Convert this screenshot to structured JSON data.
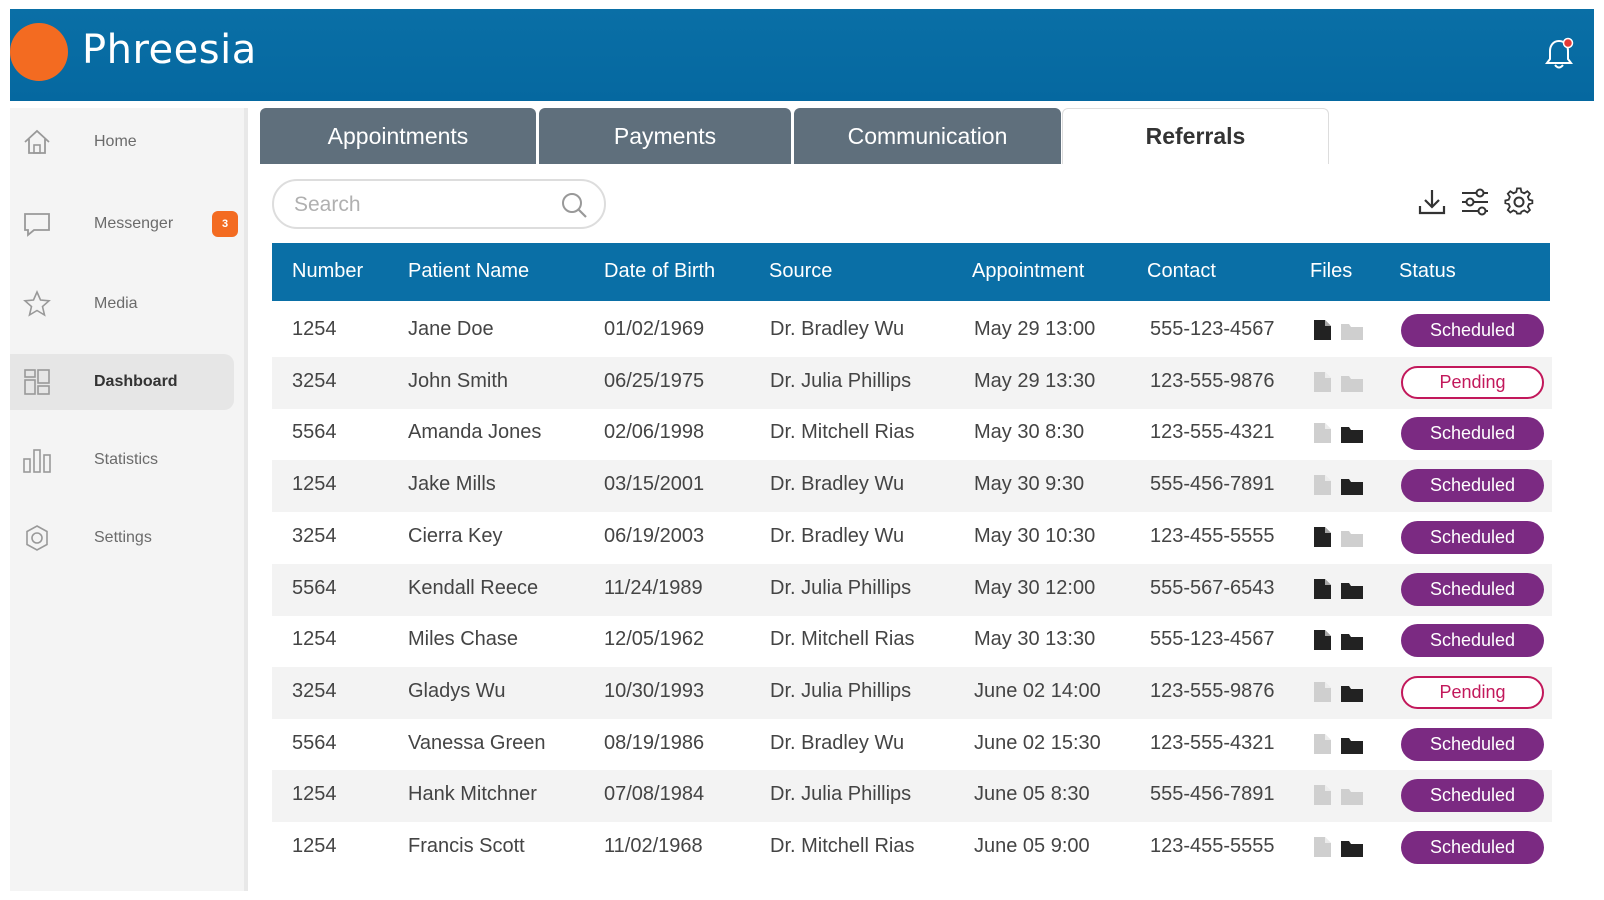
{
  "app": {
    "title": "Phreesia"
  },
  "sidebar": {
    "items": [
      {
        "label": "Home",
        "icon": "home-icon"
      },
      {
        "label": "Messenger",
        "icon": "chat-icon",
        "badge": "3"
      },
      {
        "label": "Media",
        "icon": "star-icon"
      },
      {
        "label": "Dashboard",
        "icon": "dashboard-icon",
        "active": true
      },
      {
        "label": "Statistics",
        "icon": "bar-chart-icon"
      },
      {
        "label": "Settings",
        "icon": "settings-icon"
      }
    ]
  },
  "tabs": [
    {
      "label": "Appointments"
    },
    {
      "label": "Payments"
    },
    {
      "label": "Communication"
    },
    {
      "label": "Referrals",
      "active": true
    }
  ],
  "search": {
    "placeholder": "Search",
    "value": ""
  },
  "toolbar": {
    "icons": [
      "download-icon",
      "filter-icon",
      "gear-icon"
    ]
  },
  "table": {
    "headers": [
      "Number",
      "Patient Name",
      "Date of Birth",
      "Source",
      "Appointment",
      "Contact",
      "Files",
      "Status"
    ],
    "rows": [
      {
        "number": "1254",
        "name": "Jane Doe",
        "dob": "01/02/1969",
        "source": "Dr. Bradley Wu",
        "appt": "May 29 13:00",
        "contact": "555-123-4567",
        "file": true,
        "folder": false,
        "status": "Scheduled"
      },
      {
        "number": "3254",
        "name": "John Smith",
        "dob": "06/25/1975",
        "source": "Dr. Julia Phillips",
        "appt": "May 29 13:30",
        "contact": "123-555-9876",
        "file": false,
        "folder": false,
        "status": "Pending"
      },
      {
        "number": "5564",
        "name": "Amanda Jones",
        "dob": "02/06/1998",
        "source": "Dr. Mitchell  Rias",
        "appt": "May 30 8:30",
        "contact": "123-555-4321",
        "file": false,
        "folder": true,
        "status": "Scheduled"
      },
      {
        "number": "1254",
        "name": "Jake Mills",
        "dob": "03/15/2001",
        "source": "Dr. Bradley Wu",
        "appt": "May 30 9:30",
        "contact": "555-456-7891",
        "file": false,
        "folder": true,
        "status": "Scheduled"
      },
      {
        "number": "3254",
        "name": "Cierra Key",
        "dob": "06/19/2003",
        "source": "Dr. Bradley Wu",
        "appt": "May 30 10:30",
        "contact": "123-455-5555",
        "file": true,
        "folder": false,
        "status": "Scheduled"
      },
      {
        "number": "5564",
        "name": "Kendall Reece",
        "dob": "11/24/1989",
        "source": "Dr. Julia Phillips",
        "appt": "May 30 12:00",
        "contact": "555-567-6543",
        "file": true,
        "folder": true,
        "status": "Scheduled"
      },
      {
        "number": "1254",
        "name": "Miles Chase",
        "dob": "12/05/1962",
        "source": "Dr. Mitchell  Rias",
        "appt": "May 30 13:30",
        "contact": "555-123-4567",
        "file": true,
        "folder": true,
        "status": "Scheduled"
      },
      {
        "number": "3254",
        "name": "Gladys Wu",
        "dob": "10/30/1993",
        "source": "Dr. Julia Phillips",
        "appt": "June 02 14:00",
        "contact": "123-555-9876",
        "file": false,
        "folder": true,
        "status": "Pending"
      },
      {
        "number": "5564",
        "name": "Vanessa Green",
        "dob": "08/19/1986",
        "source": "Dr. Bradley Wu",
        "appt": "June 02 15:30",
        "contact": "123-555-4321",
        "file": false,
        "folder": true,
        "status": "Scheduled"
      },
      {
        "number": "1254",
        "name": "Hank Mitchner",
        "dob": "07/08/1984",
        "source": "Dr. Julia Phillips",
        "appt": "June 05 8:30",
        "contact": "555-456-7891",
        "file": false,
        "folder": false,
        "status": "Scheduled"
      },
      {
        "number": "1254",
        "name": "Francis Scott",
        "dob": "11/02/1968",
        "source": "Dr. Mitchell  Rias",
        "appt": "June 05 9:00",
        "contact": "123-455-5555",
        "file": false,
        "folder": true,
        "status": "Scheduled"
      }
    ]
  },
  "colors": {
    "brand_blue": "#0a6fa6",
    "brand_orange": "#f36b21",
    "tab_gray": "#5f6f7c",
    "status_scheduled": "#7b2a82",
    "status_pending": "#c2185b",
    "file_active": "#222222",
    "file_inactive": "#cfcfcf"
  }
}
